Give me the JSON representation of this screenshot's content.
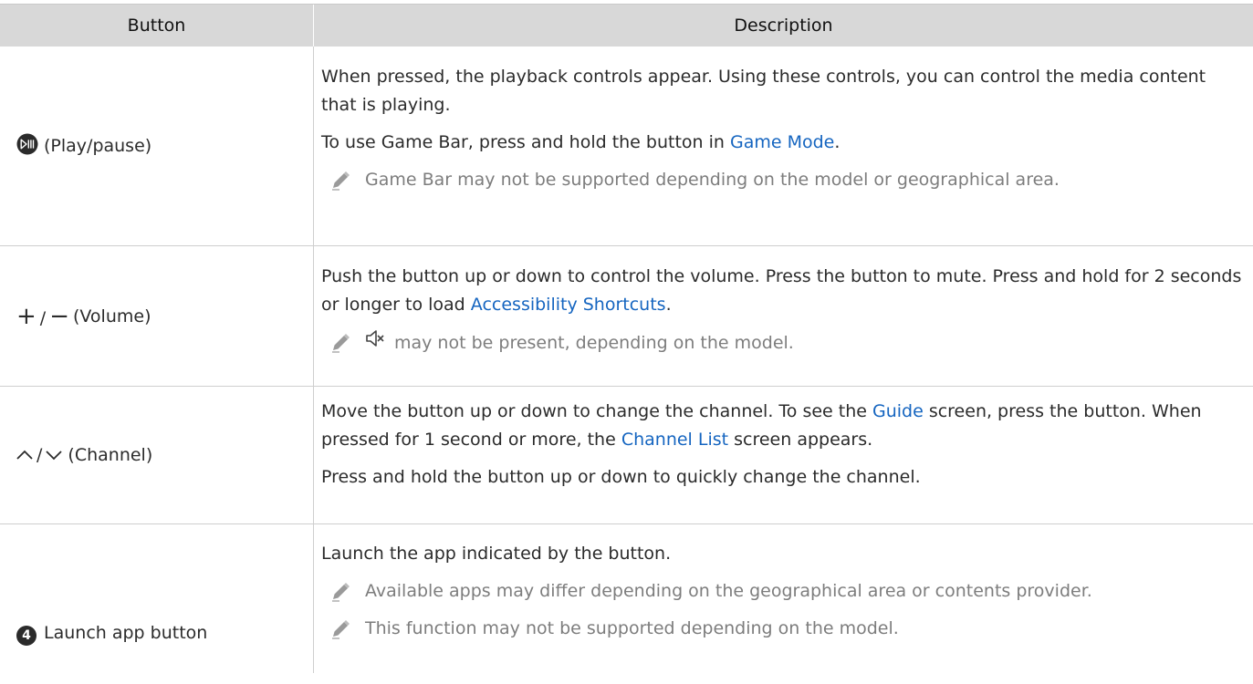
{
  "header": {
    "button_col": "Button",
    "description_col": "Description"
  },
  "rows": [
    {
      "button_icon": "play-pause-icon",
      "button_label": "(Play/pause)",
      "para1": "When pressed, the playback controls appear. Using these controls, you can control the media content that is playing.",
      "para2_prefix": "To use Game Bar, press and hold the button in ",
      "para2_link": "Game Mode",
      "para2_suffix": ".",
      "note1": "Game Bar may not be supported depending on the model or geographical area."
    },
    {
      "button_icon": "plus-minus-icon",
      "button_label_plus": "+",
      "button_label_slash": "/",
      "button_label_minus": "−",
      "button_label": "(Volume)",
      "para1_prefix": "Push the button up or down to control the volume. Press the button to mute. Press and hold for 2 seconds or longer to load ",
      "para1_link": "Accessibility Shortcuts",
      "para1_suffix": ".",
      "note1_icon": "mute-icon",
      "note1": "may not be present, depending on the model."
    },
    {
      "button_icon": "channel-up-down-icon",
      "button_label_slash": "/",
      "button_label": "(Channel)",
      "para1_a": "Move the button up or down to change the channel. To see the ",
      "para1_link1": "Guide",
      "para1_b": " screen, press the button. When pressed for 1 second or more, the ",
      "para1_link2": "Channel List",
      "para1_c": " screen appears.",
      "para2": "Press and hold the button up or down to quickly change the channel."
    },
    {
      "button_icon": "number-4-icon",
      "button_icon_text": "4",
      "button_label": "Launch app button",
      "para1": "Launch the app indicated by the button.",
      "note1": "Available apps may differ depending on the geographical area or contents provider.",
      "note2": "This function may not be supported depending on the model."
    }
  ],
  "colors": {
    "link": "#1565c0",
    "header_bg": "#d8d8d8",
    "note_text": "#7d7d7d"
  }
}
